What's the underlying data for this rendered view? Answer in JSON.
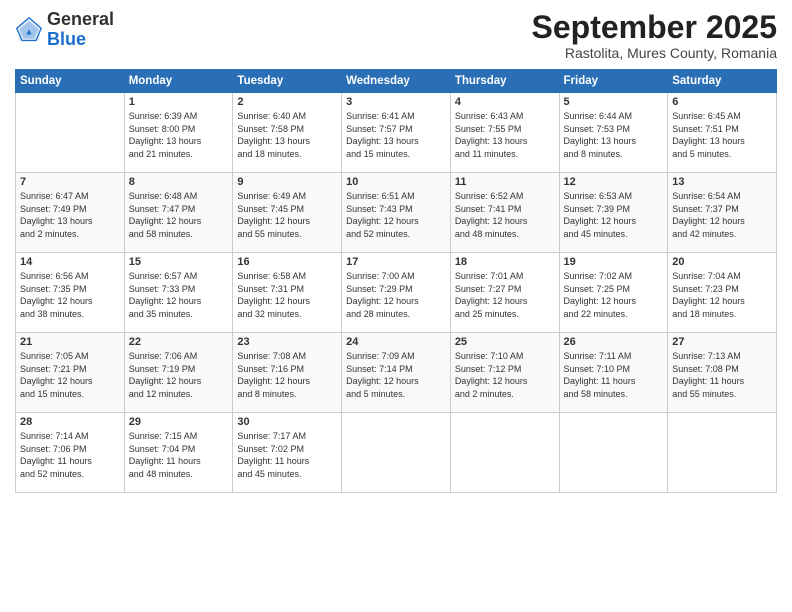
{
  "header": {
    "logo_general": "General",
    "logo_blue": "Blue",
    "month_title": "September 2025",
    "subtitle": "Rastolita, Mures County, Romania"
  },
  "days_of_week": [
    "Sunday",
    "Monday",
    "Tuesday",
    "Wednesday",
    "Thursday",
    "Friday",
    "Saturday"
  ],
  "weeks": [
    [
      {
        "day": "",
        "content": ""
      },
      {
        "day": "1",
        "content": "Sunrise: 6:39 AM\nSunset: 8:00 PM\nDaylight: 13 hours\nand 21 minutes."
      },
      {
        "day": "2",
        "content": "Sunrise: 6:40 AM\nSunset: 7:58 PM\nDaylight: 13 hours\nand 18 minutes."
      },
      {
        "day": "3",
        "content": "Sunrise: 6:41 AM\nSunset: 7:57 PM\nDaylight: 13 hours\nand 15 minutes."
      },
      {
        "day": "4",
        "content": "Sunrise: 6:43 AM\nSunset: 7:55 PM\nDaylight: 13 hours\nand 11 minutes."
      },
      {
        "day": "5",
        "content": "Sunrise: 6:44 AM\nSunset: 7:53 PM\nDaylight: 13 hours\nand 8 minutes."
      },
      {
        "day": "6",
        "content": "Sunrise: 6:45 AM\nSunset: 7:51 PM\nDaylight: 13 hours\nand 5 minutes."
      }
    ],
    [
      {
        "day": "7",
        "content": "Sunrise: 6:47 AM\nSunset: 7:49 PM\nDaylight: 13 hours\nand 2 minutes."
      },
      {
        "day": "8",
        "content": "Sunrise: 6:48 AM\nSunset: 7:47 PM\nDaylight: 12 hours\nand 58 minutes."
      },
      {
        "day": "9",
        "content": "Sunrise: 6:49 AM\nSunset: 7:45 PM\nDaylight: 12 hours\nand 55 minutes."
      },
      {
        "day": "10",
        "content": "Sunrise: 6:51 AM\nSunset: 7:43 PM\nDaylight: 12 hours\nand 52 minutes."
      },
      {
        "day": "11",
        "content": "Sunrise: 6:52 AM\nSunset: 7:41 PM\nDaylight: 12 hours\nand 48 minutes."
      },
      {
        "day": "12",
        "content": "Sunrise: 6:53 AM\nSunset: 7:39 PM\nDaylight: 12 hours\nand 45 minutes."
      },
      {
        "day": "13",
        "content": "Sunrise: 6:54 AM\nSunset: 7:37 PM\nDaylight: 12 hours\nand 42 minutes."
      }
    ],
    [
      {
        "day": "14",
        "content": "Sunrise: 6:56 AM\nSunset: 7:35 PM\nDaylight: 12 hours\nand 38 minutes."
      },
      {
        "day": "15",
        "content": "Sunrise: 6:57 AM\nSunset: 7:33 PM\nDaylight: 12 hours\nand 35 minutes."
      },
      {
        "day": "16",
        "content": "Sunrise: 6:58 AM\nSunset: 7:31 PM\nDaylight: 12 hours\nand 32 minutes."
      },
      {
        "day": "17",
        "content": "Sunrise: 7:00 AM\nSunset: 7:29 PM\nDaylight: 12 hours\nand 28 minutes."
      },
      {
        "day": "18",
        "content": "Sunrise: 7:01 AM\nSunset: 7:27 PM\nDaylight: 12 hours\nand 25 minutes."
      },
      {
        "day": "19",
        "content": "Sunrise: 7:02 AM\nSunset: 7:25 PM\nDaylight: 12 hours\nand 22 minutes."
      },
      {
        "day": "20",
        "content": "Sunrise: 7:04 AM\nSunset: 7:23 PM\nDaylight: 12 hours\nand 18 minutes."
      }
    ],
    [
      {
        "day": "21",
        "content": "Sunrise: 7:05 AM\nSunset: 7:21 PM\nDaylight: 12 hours\nand 15 minutes."
      },
      {
        "day": "22",
        "content": "Sunrise: 7:06 AM\nSunset: 7:19 PM\nDaylight: 12 hours\nand 12 minutes."
      },
      {
        "day": "23",
        "content": "Sunrise: 7:08 AM\nSunset: 7:16 PM\nDaylight: 12 hours\nand 8 minutes."
      },
      {
        "day": "24",
        "content": "Sunrise: 7:09 AM\nSunset: 7:14 PM\nDaylight: 12 hours\nand 5 minutes."
      },
      {
        "day": "25",
        "content": "Sunrise: 7:10 AM\nSunset: 7:12 PM\nDaylight: 12 hours\nand 2 minutes."
      },
      {
        "day": "26",
        "content": "Sunrise: 7:11 AM\nSunset: 7:10 PM\nDaylight: 11 hours\nand 58 minutes."
      },
      {
        "day": "27",
        "content": "Sunrise: 7:13 AM\nSunset: 7:08 PM\nDaylight: 11 hours\nand 55 minutes."
      }
    ],
    [
      {
        "day": "28",
        "content": "Sunrise: 7:14 AM\nSunset: 7:06 PM\nDaylight: 11 hours\nand 52 minutes."
      },
      {
        "day": "29",
        "content": "Sunrise: 7:15 AM\nSunset: 7:04 PM\nDaylight: 11 hours\nand 48 minutes."
      },
      {
        "day": "30",
        "content": "Sunrise: 7:17 AM\nSunset: 7:02 PM\nDaylight: 11 hours\nand 45 minutes."
      },
      {
        "day": "",
        "content": ""
      },
      {
        "day": "",
        "content": ""
      },
      {
        "day": "",
        "content": ""
      },
      {
        "day": "",
        "content": ""
      }
    ]
  ]
}
